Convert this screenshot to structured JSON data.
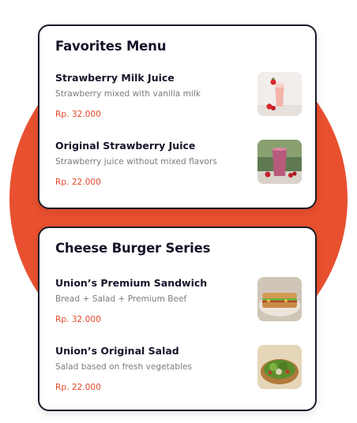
{
  "colors": {
    "accent": "#e8502f",
    "price": "#e0492a",
    "title": "#15152a",
    "muted": "#7b7b83"
  },
  "sections": [
    {
      "title": "Favorites Menu",
      "items": [
        {
          "name": "Strawberry Milk Juice",
          "description": "Strawberry mixed with vanilla milk",
          "price": "Rp. 32.000",
          "image_icon": "strawberry-milk-image"
        },
        {
          "name": "Original Strawberry Juice",
          "description": "Strawberry juice without mixed flavors",
          "price": "Rp. 22.000",
          "image_icon": "strawberry-juice-image"
        }
      ]
    },
    {
      "title": "Cheese Burger Series",
      "items": [
        {
          "name": "Union’s Premium Sandwich",
          "description": "Bread + Salad + Premium Beef",
          "price": "Rp. 32.000",
          "image_icon": "sandwich-image"
        },
        {
          "name": "Union’s Original Salad",
          "description": "Salad based on fresh vegetables",
          "price": "Rp. 22.000",
          "image_icon": "salad-image"
        }
      ]
    }
  ]
}
